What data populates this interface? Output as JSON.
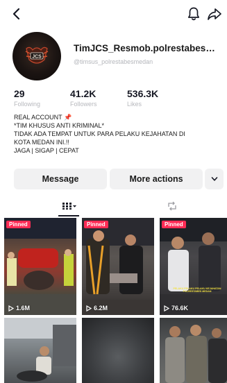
{
  "header": {
    "back_icon": "back-arrow-icon",
    "notification_icon": "bell-icon",
    "share_icon": "share-arrow-icon"
  },
  "profile": {
    "display_name": "TimJCS_Resmob.polrestabesmedan",
    "handle": "@timsus_polrestabesmedan",
    "avatar_text": "JCS",
    "stats": [
      {
        "value": "29",
        "label": "Following"
      },
      {
        "value": "41.2K",
        "label": "Followers"
      },
      {
        "value": "536.3K",
        "label": "Likes"
      }
    ],
    "bio_lines": [
      "REAL ACCOUNT",
      "*TIM KHUSUS ANTI KRIMINAL*",
      "TIDAK ADA TEMPAT UNTUK PARA PELAKU KEJAHATAN DI",
      "KOTA MEDAN INI.!!",
      "JAGA | SIGAP | CEPAT"
    ],
    "bio_emoji": "📌"
  },
  "actions": {
    "message_label": "Message",
    "more_label": "More actions",
    "dropdown_icon": "chevron-down-icon"
  },
  "tabs": {
    "videos_icon": "grid-icon",
    "reposts_icon": "repost-icon"
  },
  "videos": [
    {
      "badge": "Pinned",
      "views": "1.6M"
    },
    {
      "badge": "Pinned",
      "views": "6.2M"
    },
    {
      "badge": "Pinned",
      "views": "76.6K",
      "caption": "PELAKU PELAKU PELAKU KEJAHATAN POLRESTABES MEDAN"
    },
    {
      "badge": "",
      "views": ""
    },
    {
      "badge": "",
      "views": ""
    },
    {
      "badge": "",
      "views": ""
    }
  ],
  "colors": {
    "pinned_badge": "#fe2c55",
    "button_bg": "#f1f1f2",
    "text_primary": "#161823",
    "text_secondary": "#b4b6bb"
  }
}
